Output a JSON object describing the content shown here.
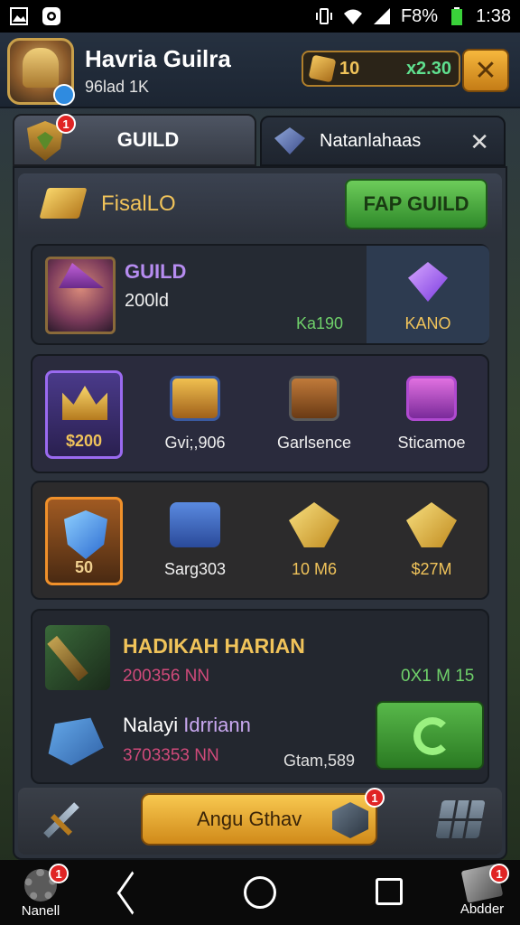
{
  "status_bar": {
    "battery": "F8%",
    "time": "1:38"
  },
  "header": {
    "player_name": "Havria Guilra",
    "player_power": "96lad 1K",
    "currency_1": "10",
    "currency_2": "x2.30"
  },
  "tabs": [
    {
      "label": "GUILD",
      "badge": "1"
    },
    {
      "label": "Natanlahaas"
    }
  ],
  "subheader": {
    "title": "FisalLO",
    "button_label": "FAP GUILD"
  },
  "card1": {
    "title": "GUILD",
    "value": "200ld",
    "reward": "Ka190",
    "side_label": "KANO"
  },
  "card2": {
    "frame_value": "$200",
    "items": [
      "Gvi;,906",
      "Garlsence",
      "Sticamoe"
    ]
  },
  "card3": {
    "frame_value": "50",
    "items": [
      "Sarg303",
      "10 M6",
      "$27M"
    ]
  },
  "card4": {
    "title": "HADIKAH HARIAN",
    "line1_left": "200356 NN",
    "line1_right": "0X1 M 15",
    "name_part1": "Nalayi ",
    "name_part2": "Idrriann",
    "line2_left": "3703353 NN",
    "line2_right": "Gtam,589"
  },
  "action_bar": {
    "main_button": "Angu Gthav",
    "badge": "1"
  },
  "nav": {
    "left_label": "Nanell",
    "left_badge": "1",
    "right_label": "Abdder",
    "right_badge": "1"
  },
  "colors": {
    "accent_gold": "#f0c35a",
    "accent_green": "#6fd06a",
    "accent_purple": "#b68cf0"
  }
}
